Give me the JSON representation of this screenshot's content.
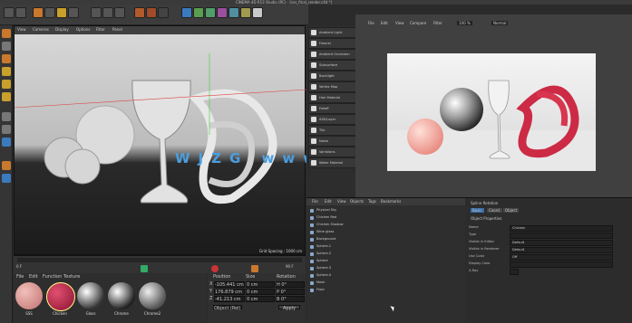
{
  "window": {
    "title": "CINEMA 4D R13 Studio (RC) - [sss_final_render.c4d *]"
  },
  "menu": [
    "File",
    "Edit",
    "Create",
    "Select",
    "Tools",
    "Mesh",
    "Snap",
    "Animate",
    "Simulate",
    "Render",
    "Sculpt",
    "MoGraph",
    "Character",
    "Plugins",
    "Script",
    "Window",
    "Help"
  ],
  "viewport": {
    "menu": [
      "View",
      "Cameras",
      "Display",
      "Options",
      "Filter",
      "Panel"
    ],
    "label": "Perspective",
    "grid": "Grid Spacing : 1000 cm"
  },
  "timeline": {
    "frame_start": "0 F",
    "frame_end": "90 F",
    "current": "0 F"
  },
  "materials": {
    "menu": [
      "File",
      "Edit",
      "Function",
      "Texture"
    ],
    "items": [
      "SSS",
      "Chicken",
      "Glass",
      "Chrome",
      "Chrome2"
    ]
  },
  "coords": {
    "headers": [
      "Position",
      "Size",
      "Rotation"
    ],
    "rows": [
      {
        "axis": "X",
        "pos": "-105.441 cm",
        "size": "0 cm",
        "rot": "H  0°"
      },
      {
        "axis": "Y",
        "pos": "176.879 cm",
        "size": "0 cm",
        "rot": "P  0°"
      },
      {
        "axis": "Z",
        "pos": "-41.213 cm",
        "size": "0 cm",
        "rot": "B  0°"
      }
    ],
    "mode": "Object (Rel)",
    "apply": "Apply"
  },
  "object_panel": [
    "Ambient Light",
    "Fresnel",
    "Ambient Occlusion",
    "Subsurface",
    "Backlight",
    "Vertex Map",
    "Hair Material",
    "Falloff",
    "ASE/Layer",
    "Tile",
    "Noise",
    "Varistions",
    "Water Material"
  ],
  "render_view": {
    "toolbar": [
      "File",
      "Edit",
      "View",
      "Compare",
      "Filter"
    ],
    "zoom": "100 %",
    "mode": "Normal"
  },
  "scene": {
    "menu": [
      "File",
      "Edit",
      "View",
      "Objects",
      "Tags",
      "Bookmarks"
    ],
    "rows": [
      "Physical Sky",
      "Chicken Red",
      "Chicken Shadow",
      "Wine glass",
      "Background",
      "Sphere.1",
      "Sphere.2",
      "Sphere",
      "Sphere.3",
      "Sphere.4",
      "Mesh",
      "Floor"
    ]
  },
  "attributes": {
    "header": "Spline Rotation",
    "title": "Object Properties",
    "tabs": [
      "Basic",
      "Coord.",
      "Object"
    ],
    "rows": [
      {
        "label": "Name",
        "value": "Chicken"
      },
      {
        "label": "Type",
        "value": ""
      },
      {
        "label": "Visible in Editor",
        "value": "Default"
      },
      {
        "label": "Visible in Renderer",
        "value": "Default"
      },
      {
        "label": "Use Color",
        "value": "Off"
      },
      {
        "label": "Display Color",
        "value": ""
      },
      {
        "label": "X-Ray",
        "value": ""
      }
    ]
  },
  "watermark": "WJZG  www.gdnxxfb.cn"
}
